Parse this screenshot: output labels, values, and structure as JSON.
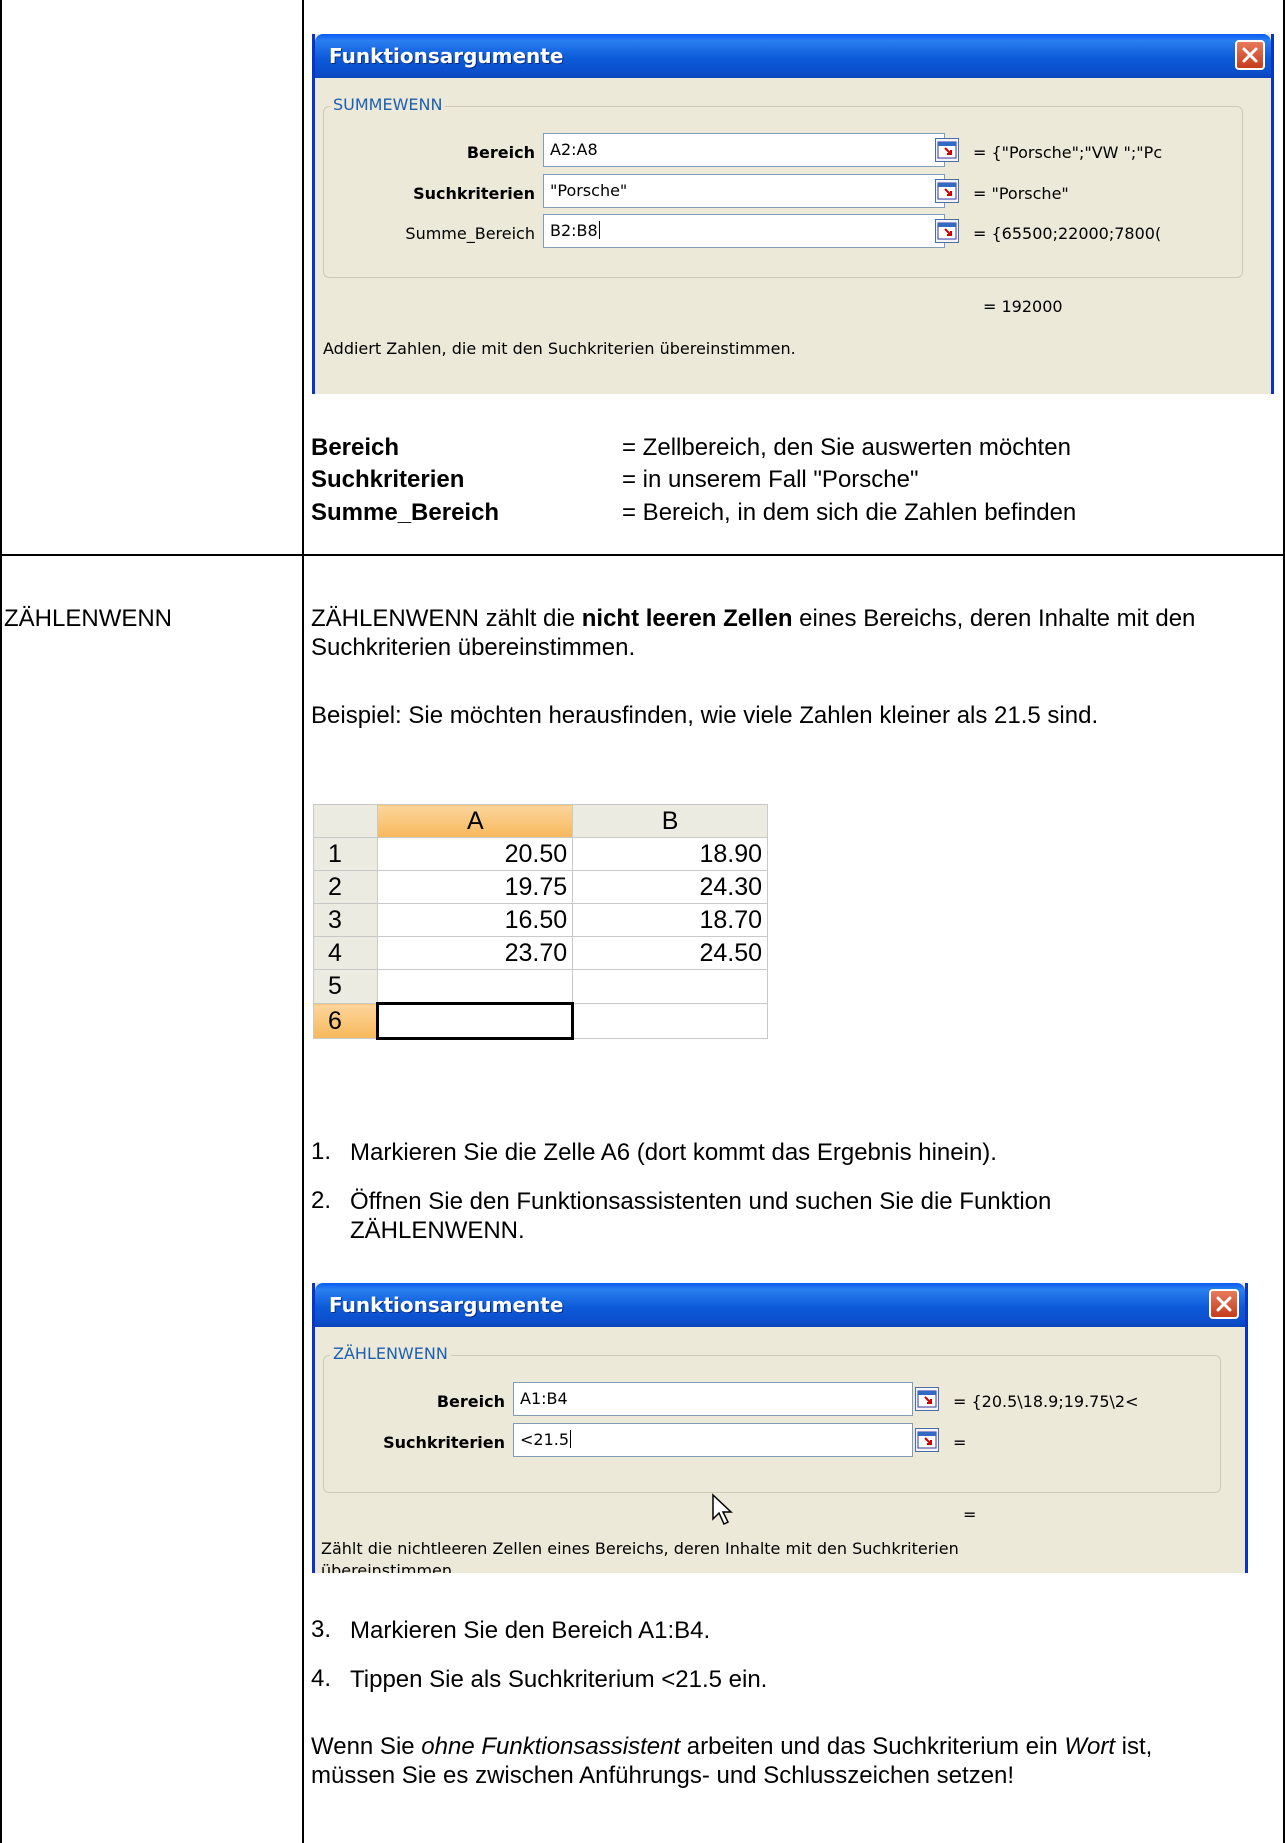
{
  "dialog1": {
    "title": "Funktionsargumente",
    "group": "SUMMEWENN",
    "args": [
      {
        "label": "Bereich",
        "value": "A2:A8",
        "result": "= {\"Porsche\";\"VW \";\"Pc"
      },
      {
        "label": "Suchkriterien",
        "value": "\"Porsche\"",
        "result": "= \"Porsche\""
      },
      {
        "label": "Summe_Bereich",
        "value": "B2:B8",
        "result": "= {65500;22000;7800("
      }
    ],
    "formula_result": "= 192000",
    "description": "Addiert Zahlen, die mit den Suchkriterien übereinstimmen."
  },
  "definitions": [
    {
      "term": "Bereich",
      "desc": "= Zellbereich, den Sie auswerten möchten"
    },
    {
      "term": "Suchkriterien",
      "desc": "= in unserem Fall \"Porsche\""
    },
    {
      "term": "Summe_Bereich",
      "desc": "= Bereich, in dem sich die Zahlen befinden"
    }
  ],
  "section": {
    "label": "ZÄHLENWENN",
    "intro_before": "ZÄHLENWENN zählt die ",
    "intro_bold": "nicht leeren Zellen",
    "intro_after": " eines Bereichs, deren Inhalte mit den Suchkriterien übereinstimmen.",
    "example": "Beispiel: Sie möchten herausfinden, wie viele Zahlen kleiner als 21.5 sind."
  },
  "sheet": {
    "columns": [
      "A",
      "B"
    ],
    "rows": [
      {
        "num": "1",
        "a": "20.50",
        "b": "18.90"
      },
      {
        "num": "2",
        "a": "19.75",
        "b": "24.30"
      },
      {
        "num": "3",
        "a": "16.50",
        "b": "18.70"
      },
      {
        "num": "4",
        "a": "23.70",
        "b": "24.50"
      },
      {
        "num": "5",
        "a": "",
        "b": ""
      },
      {
        "num": "6",
        "a": "",
        "b": ""
      }
    ]
  },
  "steps_a": [
    {
      "num": "1.",
      "text": "Markieren Sie die Zelle A6 (dort kommt das Ergebnis hinein)."
    },
    {
      "num": "2.",
      "text": "Öffnen Sie den Funktionsassistenten und suchen Sie die Funktion ZÄHLENWENN."
    }
  ],
  "dialog2": {
    "title": "Funktionsargumente",
    "group": "ZÄHLENWENN",
    "args": [
      {
        "label": "Bereich",
        "value": "A1:B4",
        "result": "= {20.5\\18.9;19.75\\2<"
      },
      {
        "label": "Suchkriterien",
        "value": "<21.5",
        "result": "="
      }
    ],
    "formula_result": "=",
    "description": "Zählt die nichtleeren Zellen eines Bereichs, deren Inhalte mit den Suchkriterien",
    "description2": "übereinstimmen."
  },
  "steps_b": [
    {
      "num": "3.",
      "text": "Markieren Sie den Bereich A1:B4."
    },
    {
      "num": "4.",
      "text": "Tippen Sie als Suchkriterium <21.5 ein."
    }
  ],
  "closing": {
    "p1": "Wenn Sie ",
    "p1_italic": "ohne Funktionsassistent",
    "p2": " arbeiten und das Suchkriterium ein ",
    "p2_italic": "Wort",
    "p3": " ist, müssen Sie es zwischen Anführungs- und Schlusszeichen setzen!"
  },
  "colors": {
    "titlebar": "#0a5cf5",
    "dialog_bg": "#ece9d8",
    "selected_header": "#f7b85b"
  }
}
